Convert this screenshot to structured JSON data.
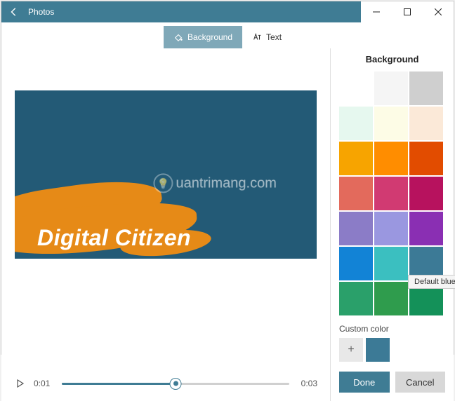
{
  "title_bar": {
    "app_name": "Photos"
  },
  "tabs": {
    "background": {
      "label": "Background",
      "active": true
    },
    "text": {
      "label": "Text",
      "active": false
    }
  },
  "preview": {
    "content_text": "Digital Citizen",
    "watermark": "uantrimang.com",
    "background_color": "#235a76",
    "accent_color": "#e68a17"
  },
  "timeline": {
    "current_time": "0:01",
    "duration": "0:03",
    "progress_percent": 50
  },
  "panel": {
    "title": "Background",
    "swatches": [
      "#ffffff",
      "#f5f5f5",
      "#cfcfcf",
      "#e6f8ef",
      "#fdfce6",
      "#fbe9d8",
      "#f7a400",
      "#ff8d00",
      "#e24c00",
      "#e36a5c",
      "#d13a72",
      "#b7125e",
      "#8b7cc7",
      "#9a97e0",
      "#8a2fb3",
      "#1283d6",
      "#3bbfc0",
      "#3c7a96",
      "#2aa06a",
      "#2f9c4d",
      "#149159"
    ],
    "tooltip": "Default blue",
    "tooltip_index": 17,
    "custom_label": "Custom color",
    "custom_current": "#3c7a96",
    "buttons": {
      "done": "Done",
      "cancel": "Cancel"
    }
  }
}
